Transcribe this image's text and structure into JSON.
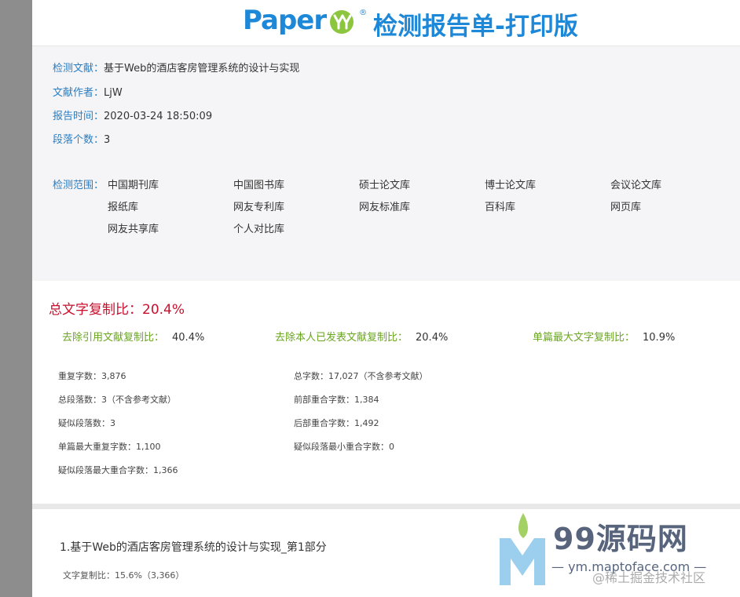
{
  "header": {
    "logo_text": "Paper",
    "logo_reg": "®",
    "title": "检测报告单-打印版"
  },
  "info": {
    "doc_label": "检测文献：",
    "doc_value": "基于Web的酒店客房管理系统的设计与实现",
    "author_label": "文献作者：",
    "author_value": "LjW",
    "time_label": "报告时间：",
    "time_value": "2020-03-24 18:50:09",
    "paragraphs_label": "段落个数：",
    "paragraphs_value": "3",
    "scope_label": "检测范围：",
    "scope": [
      "中国期刊库",
      "中国图书库",
      "硕士论文库",
      "博士论文库",
      "会议论文库",
      "报纸库",
      "网友专利库",
      "网友标准库",
      "百科库",
      "网页库",
      "网友共享库",
      "个人对比库"
    ]
  },
  "summary": {
    "total_ratio": "总文字复制比：20.4%",
    "ratios": [
      {
        "label": "去除引用文献复制比：",
        "value": "40.4%"
      },
      {
        "label": "去除本人已发表文献复制比：",
        "value": "20.4%"
      },
      {
        "label": "单篇最大文字复制比：",
        "value": "10.9%"
      }
    ],
    "stats_left": [
      "重复字数：3,876",
      "总段落数：3（不含参考文献）",
      "疑似段落数：3",
      "单篇最大重复字数：1,100",
      "疑似段落最大重合字数：1,366"
    ],
    "stats_right": [
      "总字数：17,027（不含参考文献）",
      "前部重合字数：1,384",
      "后部重合字数：1,492",
      "疑似段落最小重合字数：0"
    ]
  },
  "section": {
    "title": "1.基于Web的酒店客房管理系统的设计与实现_第1部分",
    "ratio": "文字复制比：15.6%（3,366）"
  },
  "watermark": {
    "site": "99源码网",
    "url": "— ym.maptoface.com —",
    "community": "@稀土掘金技术社区"
  },
  "colors": {
    "brand_blue": "#1e88d8",
    "label_blue": "#2b7dc0",
    "total_red": "#c8102e",
    "ratio_green": "#6aa521"
  }
}
